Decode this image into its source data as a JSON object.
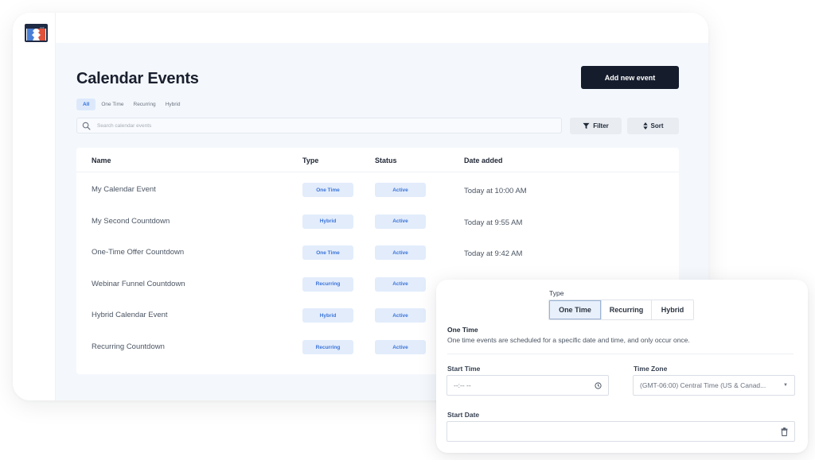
{
  "app": {
    "logo_icon": "clickfunnels-logo-icon"
  },
  "header": {
    "title": "Calendar Events",
    "add_button_label": "Add new event"
  },
  "filters": {
    "tabs": [
      {
        "label": "All",
        "active": true
      },
      {
        "label": "One Time",
        "active": false
      },
      {
        "label": "Recurring",
        "active": false
      },
      {
        "label": "Hybrid",
        "active": false
      }
    ]
  },
  "search": {
    "placeholder": "Search calendar events",
    "value": "",
    "icon": "search-icon"
  },
  "toolbar": {
    "filter_label": "Filter",
    "filter_icon": "funnel-icon",
    "sort_label": "Sort",
    "sort_icon": "sort-arrows-icon"
  },
  "table": {
    "columns": [
      "Name",
      "Type",
      "Status",
      "Date added"
    ],
    "rows": [
      {
        "name": "My Calendar Event",
        "type": "One Time",
        "status": "Active",
        "date_added": "Today at 10:00 AM"
      },
      {
        "name": "My Second Countdown",
        "type": "Hybrid",
        "status": "Active",
        "date_added": "Today at 9:55 AM"
      },
      {
        "name": "One-Time Offer Countdown",
        "type": "One Time",
        "status": "Active",
        "date_added": "Today at 9:42 AM"
      },
      {
        "name": "Webinar Funnel Countdown",
        "type": "Recurring",
        "status": "Active",
        "date_added": ""
      },
      {
        "name": "Hybrid Calendar Event",
        "type": "Hybrid",
        "status": "Active",
        "date_added": ""
      },
      {
        "name": "Recurring Countdown",
        "type": "Recurring",
        "status": "Active",
        "date_added": ""
      }
    ]
  },
  "type_panel": {
    "type_label": "Type",
    "options": [
      {
        "label": "One Time",
        "selected": true
      },
      {
        "label": "Recurring",
        "selected": false
      },
      {
        "label": "Hybrid",
        "selected": false
      }
    ],
    "heading": "One Time",
    "description": "One time events are scheduled for a specific date and time, and only occur once.",
    "start_time": {
      "label": "Start Time",
      "value": "--:-- --",
      "icon": "clock-icon"
    },
    "time_zone": {
      "label": "Time Zone",
      "value": "(GMT-06:00) Central Time (US & Canad...",
      "icon": "caret-down-icon"
    },
    "start_date": {
      "label": "Start Date",
      "value": "",
      "icon": "trash-icon"
    }
  },
  "colors": {
    "primary_dark": "#151c2c",
    "accent_blue": "#3b74d8",
    "pill_bg": "#e2ecfb",
    "content_bg": "#f4f8fc"
  }
}
